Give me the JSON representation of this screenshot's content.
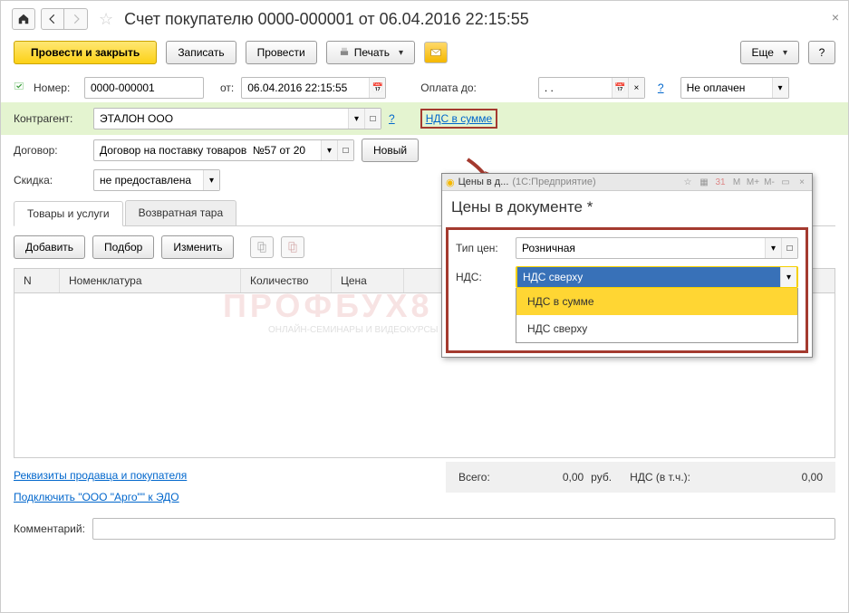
{
  "title": "Счет покупателю 0000-000001 от 06.04.2016 22:15:55",
  "toolbar": {
    "post_close": "Провести и закрыть",
    "save": "Записать",
    "post": "Провести",
    "print": "Печать",
    "more": "Еще",
    "help": "?"
  },
  "fields": {
    "number_label": "Номер:",
    "number": "0000-000001",
    "date_label": "от:",
    "date": "06.04.2016 22:15:55",
    "paydue_label": "Оплата до:",
    "paydue": ". .",
    "status": "Не оплачен",
    "contractor_label": "Контрагент:",
    "contractor": "ЭТАЛОН ООО",
    "vat_link": "НДС в сумме",
    "contract_label": "Договор:",
    "contract": "Договор на поставку товаров  №57 от 20",
    "new_btn": "Новый",
    "discount_label": "Скидка:",
    "discount": "не предоставлена"
  },
  "tabs": {
    "goods": "Товары и услуги",
    "tara": "Возвратная тара"
  },
  "tab_toolbar": {
    "add": "Добавить",
    "pick": "Подбор",
    "edit": "Изменить"
  },
  "table": {
    "col_n": "N",
    "col_item": "Номенклатура",
    "col_qty": "Количество",
    "col_price": "Цена"
  },
  "totals": {
    "total_label": "Всего:",
    "total_val": "0,00",
    "currency": "руб.",
    "vat_label": "НДС (в т.ч.):",
    "vat_val": "0,00"
  },
  "links": {
    "req": "Реквизиты продавца и покупателя",
    "edo": "Подключить \"ООО \"Арго\"\" к ЭДО"
  },
  "comment_label": "Комментарий:",
  "popup": {
    "wintitle": "Цены в д...",
    "app": "(1С:Предприятие)",
    "header": "Цены в документе *",
    "price_type_label": "Тип цен:",
    "price_type": "Розничная",
    "vat_label": "НДС:",
    "vat_value": "НДС сверху",
    "dd1": "НДС в сумме",
    "dd2": "НДС сверху"
  },
  "watermark": "ПРОФБУХ8",
  "watermark_sub": "ОНЛАЙН-СЕМИНАРЫ И ВИДЕОКУРСЫ 1С 8"
}
